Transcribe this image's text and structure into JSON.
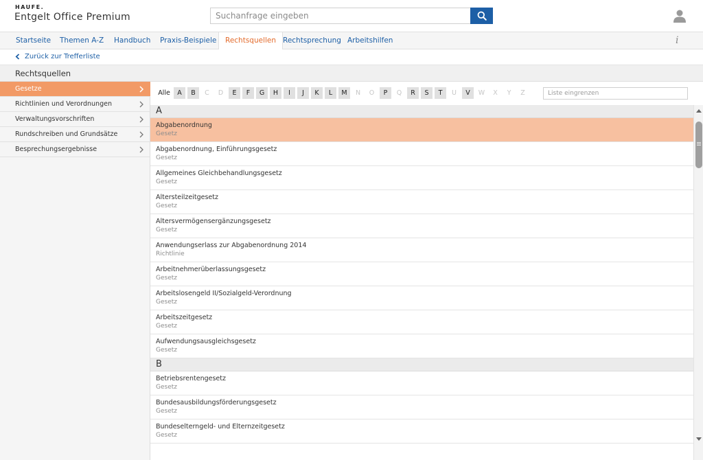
{
  "brand": {
    "publisher": "HAUFE.",
    "product": "Entgelt Office Premium"
  },
  "search": {
    "placeholder": "Suchanfrage eingeben"
  },
  "nav": {
    "items": [
      {
        "label": "Startseite"
      },
      {
        "label": "Themen A-Z"
      },
      {
        "label": "Handbuch"
      },
      {
        "label": "Praxis-Beispiele"
      },
      {
        "label": "Rechtsquellen"
      },
      {
        "label": "Rechtsprechung"
      },
      {
        "label": "Arbeitshilfen"
      }
    ],
    "active": "Rechtsquellen",
    "info_label": "i"
  },
  "back": {
    "label": "Zurück zur Trefferliste"
  },
  "section": {
    "title": "Rechtsquellen"
  },
  "sidebar": {
    "items": [
      {
        "label": "Gesetze",
        "active": true
      },
      {
        "label": "Richtlinien und Verordnungen",
        "active": false
      },
      {
        "label": "Verwaltungsvorschriften",
        "active": false
      },
      {
        "label": "Rundschreiben und Grundsätze",
        "active": false
      },
      {
        "label": "Besprechungsergebnisse",
        "active": false
      }
    ]
  },
  "alphabet": {
    "all_label": "Alle",
    "letters": [
      {
        "l": "A",
        "on": true
      },
      {
        "l": "B",
        "on": true
      },
      {
        "l": "C",
        "on": false
      },
      {
        "l": "D",
        "on": false
      },
      {
        "l": "E",
        "on": true
      },
      {
        "l": "F",
        "on": true
      },
      {
        "l": "G",
        "on": true
      },
      {
        "l": "H",
        "on": true
      },
      {
        "l": "I",
        "on": true
      },
      {
        "l": "J",
        "on": true
      },
      {
        "l": "K",
        "on": true
      },
      {
        "l": "L",
        "on": true
      },
      {
        "l": "M",
        "on": true
      },
      {
        "l": "N",
        "on": false
      },
      {
        "l": "O",
        "on": false
      },
      {
        "l": "P",
        "on": true
      },
      {
        "l": "Q",
        "on": false
      },
      {
        "l": "R",
        "on": true
      },
      {
        "l": "S",
        "on": true
      },
      {
        "l": "T",
        "on": true
      },
      {
        "l": "U",
        "on": false
      },
      {
        "l": "V",
        "on": true
      },
      {
        "l": "W",
        "on": false
      },
      {
        "l": "X",
        "on": false
      },
      {
        "l": "Y",
        "on": false
      },
      {
        "l": "Z",
        "on": false
      }
    ],
    "filter_placeholder": "Liste eingrenzen"
  },
  "list": {
    "groups": [
      {
        "letter": "A",
        "items": [
          {
            "title": "Abgabenordnung",
            "type": "Gesetz",
            "selected": true
          },
          {
            "title": "Abgabenordnung, Einführungsgesetz",
            "type": "Gesetz"
          },
          {
            "title": "Allgemeines Gleichbehandlungsgesetz",
            "type": "Gesetz"
          },
          {
            "title": "Altersteilzeitgesetz",
            "type": "Gesetz"
          },
          {
            "title": "Altersvermögensergänzungsgesetz",
            "type": "Gesetz"
          },
          {
            "title": "Anwendungserlass zur Abgabenordnung 2014",
            "type": "Richtlinie"
          },
          {
            "title": "Arbeitnehmerüberlassungsgesetz",
            "type": "Gesetz"
          },
          {
            "title": "Arbeitslosengeld II/Sozialgeld-Verordnung",
            "type": "Gesetz"
          },
          {
            "title": "Arbeitszeitgesetz",
            "type": "Gesetz"
          },
          {
            "title": "Aufwendungsausgleichsgesetz",
            "type": "Gesetz"
          }
        ]
      },
      {
        "letter": "B",
        "items": [
          {
            "title": "Betriebsrentengesetz",
            "type": "Gesetz"
          },
          {
            "title": "Bundesausbildungsförderungsgesetz",
            "type": "Gesetz"
          },
          {
            "title": "Bundeselterngeld- und Elternzeitgesetz",
            "type": "Gesetz"
          }
        ]
      }
    ]
  },
  "colors": {
    "accent": "#e36b2c",
    "selected_row": "#f7c0a0",
    "sidebar_active": "#f29a66",
    "link": "#1d5fa6"
  }
}
